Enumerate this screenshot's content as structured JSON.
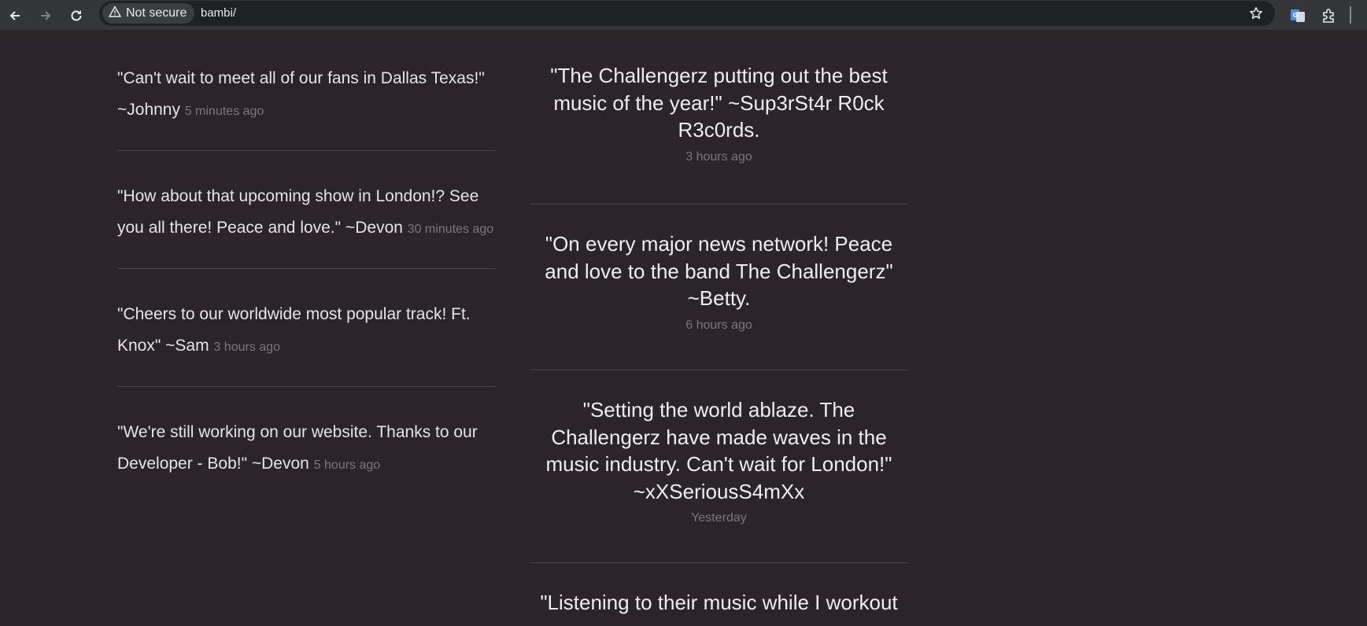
{
  "browser": {
    "security_label": "Not secure",
    "url": "bambi/"
  },
  "left_posts": [
    {
      "quote": "\"Can't wait to meet all of our fans in Dallas Texas!\" ~Johnny",
      "time": "5 minutes ago"
    },
    {
      "quote": "\"How about that upcoming show in London!? See you all there! Peace and love.\" ~Devon",
      "time": "30 minutes ago"
    },
    {
      "quote": "\"Cheers to our worldwide most popular track! Ft. Knox\" ~Sam",
      "time": "3 hours ago"
    },
    {
      "quote": "\"We're still working on our website. Thanks to our Developer - Bob!\" ~Devon",
      "time": "5 hours ago"
    }
  ],
  "right_posts": [
    {
      "quote": "\"The Challengerz putting out the best music of the year!\" ~Sup3rSt4r R0ck R3c0rds.",
      "time": "3 hours ago"
    },
    {
      "quote": "\"On every major news network! Peace and love to the band The Challengerz\" ~Betty.",
      "time": "6 hours ago"
    },
    {
      "quote": "\"Setting the world ablaze. The Challengerz have made waves in the music industry. Can't wait for London!\" ~xXSeriousS4mXx",
      "time": "Yesterday"
    },
    {
      "quote": "\"Listening to their music while I workout",
      "time": ""
    }
  ]
}
